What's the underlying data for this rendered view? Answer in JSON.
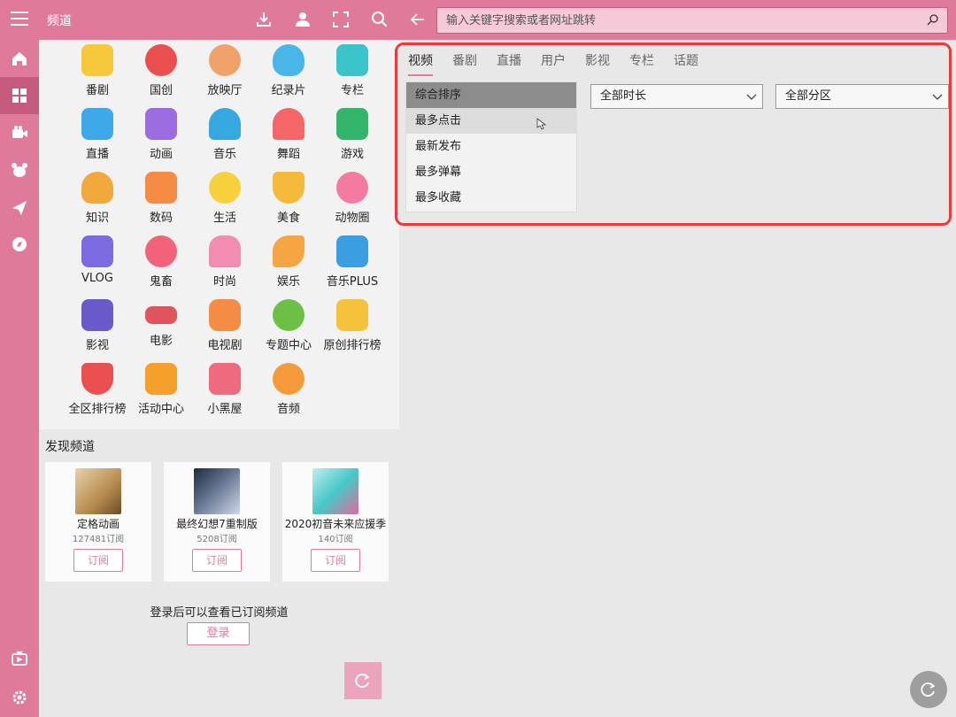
{
  "header": {
    "title": "频道",
    "search_placeholder": "输入关键字搜索或者网址跳转",
    "icons": [
      "download-icon",
      "user-icon",
      "scan-icon",
      "search-icon",
      "back-arrow-icon"
    ]
  },
  "rail": {
    "items": [
      "home-icon",
      "channel-icon",
      "live-icon",
      "bear-icon",
      "plane-icon",
      "compass-icon",
      "tv-icon",
      "settings-icon"
    ],
    "active_index": 1
  },
  "channels": [
    {
      "label": "番剧",
      "color": "#f6c93b"
    },
    {
      "label": "国创",
      "color": "#ea4e4e"
    },
    {
      "label": "放映厅",
      "color": "#f1a26a"
    },
    {
      "label": "纪录片",
      "color": "#4ab6e8"
    },
    {
      "label": "专栏",
      "color": "#3ac4c9"
    },
    {
      "label": "直播",
      "color": "#3ea9e8"
    },
    {
      "label": "动画",
      "color": "#9b6be0"
    },
    {
      "label": "音乐",
      "color": "#35a8e0"
    },
    {
      "label": "舞蹈",
      "color": "#f56767"
    },
    {
      "label": "游戏",
      "color": "#33b66b"
    },
    {
      "label": "知识",
      "color": "#f2a93b"
    },
    {
      "label": "数码",
      "color": "#f58c45"
    },
    {
      "label": "生活",
      "color": "#f7d13c"
    },
    {
      "label": "美食",
      "color": "#f5b93b"
    },
    {
      "label": "动物圈",
      "color": "#f57aa0"
    },
    {
      "label": "VLOG",
      "color": "#7a6be0"
    },
    {
      "label": "鬼畜",
      "color": "#f2637b"
    },
    {
      "label": "时尚",
      "color": "#f28db1"
    },
    {
      "label": "娱乐",
      "color": "#f5a642"
    },
    {
      "label": "音乐PLUS",
      "color": "#3a9ee0"
    },
    {
      "label": "影视",
      "color": "#6a5ac9"
    },
    {
      "label": "电影",
      "color": "#e0545e"
    },
    {
      "label": "电视剧",
      "color": "#f58c45"
    },
    {
      "label": "专题中心",
      "color": "#6cc045"
    },
    {
      "label": "原创排行榜",
      "color": "#f5c23b"
    },
    {
      "label": "全区排行榜",
      "color": "#ea5050"
    },
    {
      "label": "活动中心",
      "color": "#f5a02a"
    },
    {
      "label": "小黑屋",
      "color": "#ee6a7d"
    },
    {
      "label": "音频",
      "color": "#f59a3b"
    }
  ],
  "discover": {
    "heading": "发现频道",
    "cards": [
      {
        "name": "定格动画",
        "count": "127481订阅",
        "subscribe": "订阅",
        "thumb_color": "#c9a36a"
      },
      {
        "name": "最终幻想7重制版",
        "count": "5208订阅",
        "subscribe": "订阅",
        "thumb_color": "#4a5a7a"
      },
      {
        "name": "2020初音未来应援季",
        "count": "140订阅",
        "subscribe": "订阅",
        "thumb_color": "#6ad0d0"
      }
    ],
    "login_hint": "登录后可以查看已订阅频道",
    "login_button": "登录"
  },
  "content": {
    "tabs": [
      "视频",
      "番剧",
      "直播",
      "用户",
      "影视",
      "专栏",
      "话题"
    ],
    "active_tab": 0,
    "sort_options": [
      "综合排序",
      "最多点击",
      "最新发布",
      "最多弹幕",
      "最多收藏"
    ],
    "selected_sort": 0,
    "hovered_sort": 1,
    "duration_filter": "全部时长",
    "zone_filter": "全部分区"
  },
  "colors": {
    "accent": "#e07a9b",
    "accent_dark": "#c55b7e",
    "highlight_border": "#ea3a3a"
  }
}
